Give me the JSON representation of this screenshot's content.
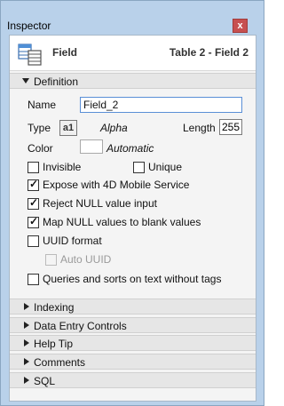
{
  "window": {
    "title": "Inspector",
    "close": "x"
  },
  "header": {
    "field_label": "Field",
    "path": "Table 2 - Field 2"
  },
  "definition": {
    "section_label": "Definition",
    "name_label": "Name",
    "name_value": "Field_2",
    "type_label": "Type",
    "type_badge": "a1",
    "type_value": "Alpha",
    "length_label": "Length",
    "length_value": "255",
    "color_label": "Color",
    "color_value": "Automatic",
    "options": {
      "invisible": {
        "label": "Invisible",
        "checked": false
      },
      "unique": {
        "label": "Unique",
        "checked": false
      },
      "expose": {
        "label": "Expose with 4D Mobile Service",
        "checked": true
      },
      "reject_null": {
        "label": "Reject NULL value input",
        "checked": true
      },
      "map_null": {
        "label": "Map NULL values to blank values",
        "checked": true
      },
      "uuid": {
        "label": "UUID format",
        "checked": false
      },
      "auto_uuid": {
        "label": "Auto UUID",
        "checked": false,
        "disabled": true
      },
      "queries_sorts": {
        "label": "Queries and sorts on text without tags",
        "checked": false
      }
    }
  },
  "sections": [
    {
      "label": "Indexing"
    },
    {
      "label": "Data Entry Controls"
    },
    {
      "label": "Help Tip"
    },
    {
      "label": "Comments"
    },
    {
      "label": "SQL"
    }
  ]
}
